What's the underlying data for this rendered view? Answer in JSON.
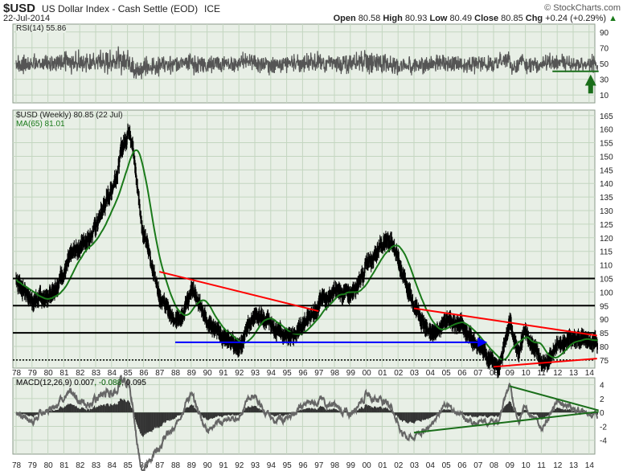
{
  "header": {
    "symbol": "$USD",
    "name": "US Dollar Index - Cash Settle (EOD)",
    "exchange": "ICE",
    "date": "22-Jul-2014",
    "copyright": "© StockCharts.com",
    "open_label": "Open",
    "open": "80.58",
    "high_label": "High",
    "high": "80.93",
    "low_label": "Low",
    "low": "80.49",
    "close_label": "Close",
    "close": "80.85",
    "chg_label": "Chg",
    "chg": "+0.24 (+0.29%)"
  },
  "colors": {
    "price": "#000000",
    "ma": "#1a7a1a",
    "rsi": "#555555",
    "macd_hist": "#333333",
    "trend_red": "#ff0000",
    "arrow_blue": "#0000ff",
    "trend_green": "#1a6e1a",
    "panel_bg": "#e8efe6",
    "grid": "#c3d6c0"
  },
  "chart_data": [
    {
      "type": "line",
      "title": "RSI(14) 55.86",
      "legend": "RSI(14) 55.86",
      "ylim": [
        0,
        100
      ],
      "yticks": [
        10,
        30,
        50,
        70,
        90
      ]
    },
    {
      "type": "line",
      "title": "$USD (Weekly) 80.85 (22 Jul)",
      "legend": [
        "$USD (Weekly) 80.85 (22 Jul)",
        "MA(65) 81.01"
      ],
      "ylim": [
        72,
        167
      ],
      "yticks": [
        75,
        80,
        85,
        90,
        95,
        100,
        105,
        110,
        115,
        120,
        125,
        130,
        135,
        140,
        145,
        150,
        155,
        160,
        165
      ],
      "x": [
        1978,
        1979,
        1980,
        1981,
        1982,
        1983,
        1984,
        1985.15,
        1985.6,
        1986,
        1987,
        1988,
        1989,
        1989.5,
        1990,
        1991,
        1992,
        1993,
        1994,
        1995,
        1996,
        1997,
        1998,
        1999,
        2000,
        2001,
        2001.6,
        2002,
        2003,
        2004,
        2005,
        2006,
        2007,
        2008.3,
        2009,
        2009.6,
        2010,
        2010.5,
        2011,
        2011.5,
        2012,
        2013,
        2014.55
      ],
      "values": [
        105,
        97,
        98,
        108,
        117,
        124,
        138,
        163,
        140,
        122,
        100,
        88,
        100,
        96,
        90,
        83,
        80,
        92,
        88,
        83,
        87,
        96,
        100,
        99,
        110,
        118,
        120,
        112,
        95,
        85,
        89,
        88,
        80,
        72,
        88,
        78,
        87,
        80,
        74,
        76,
        81,
        83,
        80.85
      ],
      "horizontal_lines": [
        105,
        95,
        85,
        75
      ],
      "annotations": [
        {
          "type": "red-trendline",
          "from": [
            1987,
            107.5
          ],
          "to": [
            1997,
            93
          ]
        },
        {
          "type": "red-trendline",
          "from": [
            2003,
            94
          ],
          "to": [
            2014.5,
            84
          ]
        },
        {
          "type": "red-trendline",
          "from": [
            2008,
            72.5
          ],
          "to": [
            2014.5,
            75.5
          ]
        },
        {
          "type": "blue-arrow",
          "from": [
            1988,
            81.5
          ],
          "to": [
            2007,
            81.5
          ]
        }
      ],
      "xtick_labels": [
        "78",
        "79",
        "80",
        "81",
        "82",
        "83",
        "84",
        "85",
        "86",
        "87",
        "88",
        "89",
        "90",
        "91",
        "92",
        "93",
        "94",
        "95",
        "96",
        "97",
        "98",
        "99",
        "00",
        "01",
        "02",
        "03",
        "04",
        "05",
        "06",
        "07",
        "08",
        "09",
        "10",
        "11",
        "12",
        "13",
        "14"
      ]
    },
    {
      "type": "line",
      "title": "MACD(12,26,9) 0.007, -0.088, 0.095",
      "legend": [
        "MACD(12,26,9) 0.007",
        ", -0.088",
        ", 0.095"
      ],
      "ylim": [
        -6,
        5
      ],
      "yticks": [
        4,
        2,
        0,
        -2,
        -4
      ]
    }
  ]
}
